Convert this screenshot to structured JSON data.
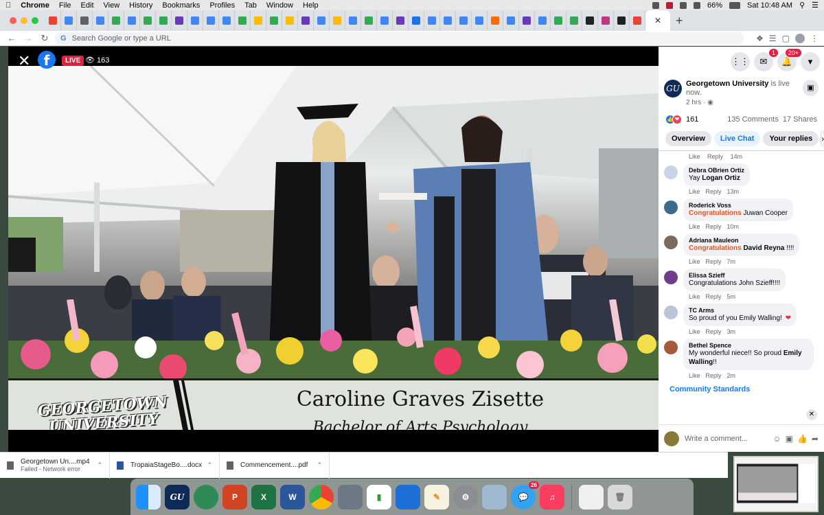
{
  "menubar": {
    "app": "Chrome",
    "items": [
      "File",
      "Edit",
      "View",
      "History",
      "Bookmarks",
      "Profiles",
      "Tab",
      "Window",
      "Help"
    ],
    "battery": "66%",
    "clock": "Sat 10:48 AM"
  },
  "browser": {
    "omnibox_placeholder": "Search Google or type a URL",
    "tab_count_icons": 44
  },
  "video": {
    "live_label": "LIVE",
    "viewer_count": "163",
    "overlay_logo_line1": "GEORGETOWN",
    "overlay_logo_line2": "UNIVERSITY",
    "graduate_name": "Caroline Graves Zisette",
    "graduate_degree": "Bachelor of Arts Psychology"
  },
  "fb": {
    "topbar": {
      "messenger_badge": "1",
      "notifications_badge": "20+"
    },
    "post": {
      "page_name": "Georgetown University",
      "status_text": " is live now.",
      "time": "2 hrs ·",
      "reaction_count": "161",
      "comments_count": "135 Comments",
      "shares_count": "17 Shares"
    },
    "tabs": [
      "Overview",
      "Live Chat",
      "Your replies"
    ],
    "first_actions": {
      "like": "Like",
      "reply": "Reply",
      "time": "14m"
    },
    "comments": [
      {
        "name": "Debra OBrien Ortiz",
        "prefix": "",
        "highlight": "",
        "text": "Yay ",
        "bold": "Logan Ortiz",
        "suffix": "",
        "time": "13m",
        "color": "#c9d3e6"
      },
      {
        "name": "Roderick Voss",
        "prefix": "",
        "highlight": "Congratulations",
        "text": " Juwan Cooper",
        "bold": "",
        "suffix": "",
        "time": "10m",
        "color": "#3d6b8a"
      },
      {
        "name": "Adriana Mauleon",
        "prefix": "",
        "highlight": "Congratulations",
        "text": " ",
        "bold": "David Reyna",
        "suffix": " !!!!",
        "time": "7m",
        "color": "#7b6a5e"
      },
      {
        "name": "Elissa Szieff",
        "prefix": "",
        "highlight": "",
        "text": "Congratulations John Szieff!!!!",
        "bold": "",
        "suffix": "",
        "time": "5m",
        "color": "#6f3d8c"
      },
      {
        "name": "TC Arms",
        "prefix": "",
        "highlight": "",
        "text": "So proud of you Emily Walling!",
        "bold": "",
        "suffix": "",
        "time": "3m",
        "color": "#b9c4d6"
      },
      {
        "name": "Bethel Spence",
        "prefix": "",
        "highlight": "",
        "text": "My wonderful niece!! So proud ",
        "bold": "Emily Walling",
        "suffix": "!!",
        "time": "2m",
        "color": "#a35b3c"
      }
    ],
    "like_label": "Like",
    "reply_label": "Reply",
    "community_standards": "Community Standards",
    "composer_placeholder": "Write a comment..."
  },
  "downloads": [
    {
      "name": "Georgetown Un....mp4",
      "status": "Failed - Network error",
      "icon_color": "#5f6368"
    },
    {
      "name": "TropaiaStageBo....docx",
      "status": "",
      "icon_color": "#2b579a"
    },
    {
      "name": "Commencement....pdf",
      "status": "",
      "icon_color": "#5f6368"
    }
  ],
  "dock": {
    "gu_app_label": "GU University Information Services",
    "messages_badge": "26"
  },
  "colors": {
    "fb_blue": "#1877f2",
    "live_red": "#e41e3f",
    "congrats_orange": "#f4511e"
  }
}
